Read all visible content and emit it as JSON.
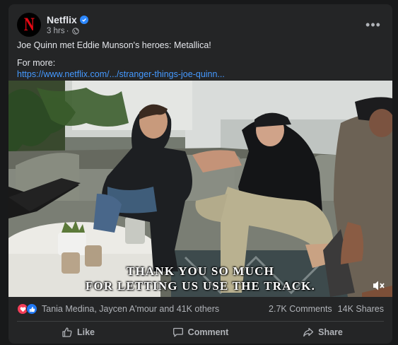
{
  "post": {
    "page_name": "Netflix",
    "avatar_letter": "N",
    "time": "3 hrs",
    "separator": "·",
    "caption": "Joe Quinn met Eddie Munson's heroes: Metallica!",
    "for_more": "For more:",
    "link": "https://www.netflix.com/.../stranger-things-joe-quinn...",
    "more_icon": "•••"
  },
  "video": {
    "subtitle_line1": "THANK YOU SO MUCH",
    "subtitle_line2": "FOR LETTING US USE THE TRACK."
  },
  "stats": {
    "reactors": "Tania Medina, Jaycen A'mour and 41K others",
    "comments": "2.7K Comments",
    "shares": "14K Shares"
  },
  "actions": {
    "like": "Like",
    "comment": "Comment",
    "share": "Share"
  },
  "colors": {
    "background": "#18191a",
    "card": "#242526",
    "link": "#4599ff",
    "verified": "#2d88ff",
    "brand_red": "#e50914"
  }
}
